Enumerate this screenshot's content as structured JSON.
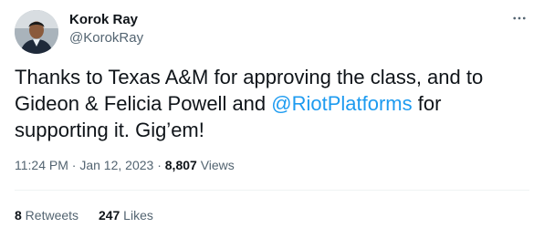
{
  "author": {
    "name": "Korok Ray",
    "handle": "@KorokRay"
  },
  "tweet": {
    "text_before": "Thanks to Texas A&M for approving the class, and to Gideon & Felicia Powell and ",
    "mention": "@RiotPlatforms",
    "text_after": " for supporting it. Gig’em!"
  },
  "meta": {
    "time": "11:24 PM",
    "sep1": " · ",
    "date": "Jan 12, 2023",
    "sep2": " · ",
    "views_count": "8,807",
    "views_label": " Views"
  },
  "stats": {
    "retweets_count": "8",
    "retweets_label": " Retweets",
    "likes_count": "247",
    "likes_label": " Likes"
  },
  "icons": {
    "more": "more-horizontal-icon"
  },
  "colors": {
    "text": "#0f1419",
    "secondary": "#536471",
    "link": "#1d9bf0",
    "divider": "#eff3f4"
  }
}
